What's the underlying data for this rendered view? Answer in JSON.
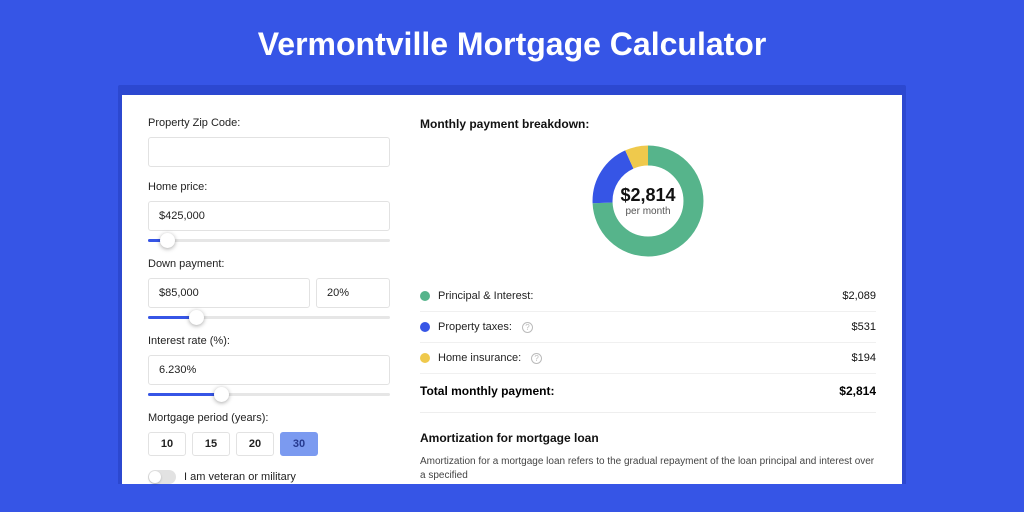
{
  "title": "Vermontville Mortgage Calculator",
  "left": {
    "zip": {
      "label": "Property Zip Code:",
      "value": ""
    },
    "price": {
      "label": "Home price:",
      "value": "$425,000",
      "slider_pct": 8
    },
    "down": {
      "label": "Down payment:",
      "amount": "$85,000",
      "percent": "20%",
      "slider_pct": 20
    },
    "rate": {
      "label": "Interest rate (%):",
      "value": "6.230%",
      "slider_pct": 30
    },
    "period": {
      "label": "Mortgage period (years):",
      "options": [
        "10",
        "15",
        "20",
        "30"
      ],
      "selected": "30"
    },
    "veteran": {
      "label": "I am veteran or military",
      "on": false
    }
  },
  "right": {
    "breakdown_title": "Monthly payment breakdown:",
    "center_amount": "$2,814",
    "center_sub": "per month",
    "items": [
      {
        "label": "Principal & Interest:",
        "value": "$2,089",
        "color": "#56b48b",
        "info": false
      },
      {
        "label": "Property taxes:",
        "value": "$531",
        "color": "#3655e6",
        "info": true
      },
      {
        "label": "Home insurance:",
        "value": "$194",
        "color": "#efc94c",
        "info": true
      }
    ],
    "total_label": "Total monthly payment:",
    "total_value": "$2,814",
    "amort_title": "Amortization for mortgage loan",
    "amort_text": "Amortization for a mortgage loan refers to the gradual repayment of the loan principal and interest over a specified"
  },
  "chart_data": {
    "type": "pie",
    "title": "Monthly payment breakdown",
    "series": [
      {
        "name": "Principal & Interest",
        "value": 2089,
        "color": "#56b48b"
      },
      {
        "name": "Property taxes",
        "value": 531,
        "color": "#3655e6"
      },
      {
        "name": "Home insurance",
        "value": 194,
        "color": "#efc94c"
      }
    ],
    "total": 2814
  }
}
